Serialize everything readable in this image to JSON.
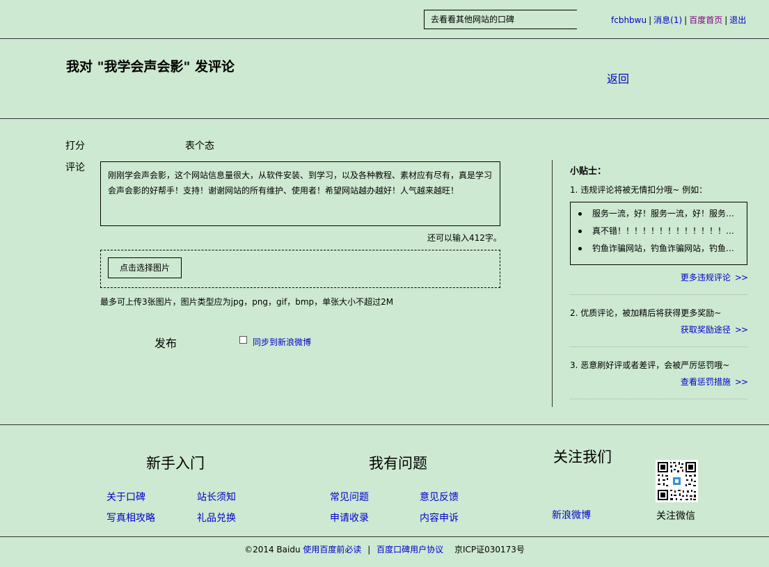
{
  "topbar": {
    "search_text": "去看看其他网站的口碑",
    "username": "fcbhbwu",
    "messages": "消息(1)",
    "home": "百度首页",
    "logout": "退出",
    "separator": "|"
  },
  "header": {
    "title": "我对 \"我学会声会影\" 发评论",
    "back": "返回"
  },
  "form": {
    "score_label": "打分",
    "attitude_label": "表个态",
    "comment_label": "评论",
    "comment_text": "刚刚学会声会影，这个网站信息量很大，从软件安装、到学习，以及各种教程、素材应有尽有，真是学习会声会影的好帮手！支持！谢谢网站的所有维护、使用者！希望网站越办越好！人气越来越旺！",
    "char_remaining": "还可以输入412字。",
    "upload_button": "点击选择图片",
    "upload_hint": "最多可上传3张图片，图片类型应为jpg，png，gif，bmp，单张大小不超过2M",
    "publish": "发布",
    "sync_label": "同步到新浪微博",
    "sync_checked": false
  },
  "tips": {
    "title": "小贴士：",
    "tip1": "1. 违规评论将被无情扣分哦~ 例如：",
    "examples": [
      "服务一流，好！服务一流，好！服务一流，好！",
      "真不错！！！！！！！！！！！！！！！！",
      "钓鱼诈骗网站，钓鱼诈骗网站，钓鱼诈骗网站"
    ],
    "link1": "更多违规评论",
    "tip2": "2. 优质评论，被加精后将获得更多奖励~",
    "link2": "获取奖励途径",
    "tip3": "3. 恶意刷好评或者差评，会被严厉惩罚哦~",
    "link3": "查看惩罚措施",
    "arrows": ">>"
  },
  "footer": {
    "col1": {
      "heading": "新手入门",
      "links": [
        "关于口碑",
        "站长须知",
        "写真相攻略",
        "礼品兑换"
      ]
    },
    "col2": {
      "heading": "我有问题",
      "links": [
        "常见问题",
        "意见反馈",
        "申请收录",
        "内容申诉"
      ]
    },
    "col3": {
      "heading": "关注我们",
      "weibo": "新浪微博",
      "wechat": "关注微信"
    },
    "copyright": "©2014 Baidu",
    "must_read": "使用百度前必读",
    "agreement": "百度口碑用户协议",
    "icp": "京ICP证030173号",
    "separator": "|"
  },
  "colors": {
    "background": "#cde9d1",
    "link": "#0000cc",
    "visited": "#800080"
  }
}
